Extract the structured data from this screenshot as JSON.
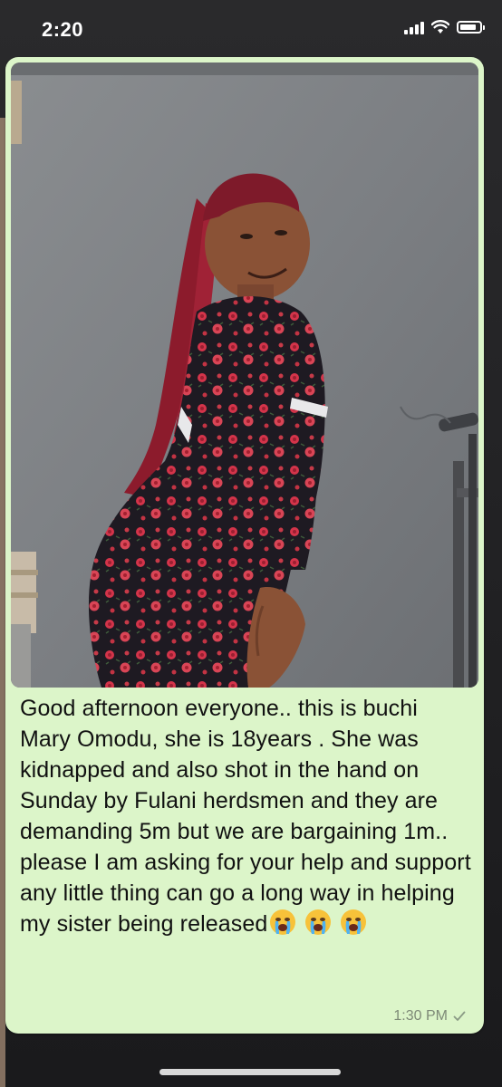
{
  "status_bar": {
    "time": "2:20",
    "battery_level": 0.85
  },
  "message": {
    "caption": "Good afternoon everyone.. this is buchi Mary Omodu, she is 18years . She was kidnapped and also shot in the hand on Sunday by Fulani herdsmen and they are demanding 5m but we are bargaining 1m.. please I am asking for your help and support any little thing can go a long way in helping my sister being released",
    "emojis": [
      "crying-face-emoji",
      "crying-face-emoji",
      "crying-face-emoji"
    ],
    "timestamp": "1:30 PM",
    "status": "sent"
  },
  "colors": {
    "bubble_bg": "#dcf5c9",
    "text": "#111111",
    "meta": "#7e8a77",
    "wall": "#7f8285",
    "dress_dark": "#1e1a22",
    "flower_red": "#d4344a",
    "hair": "#8c1b2c"
  }
}
